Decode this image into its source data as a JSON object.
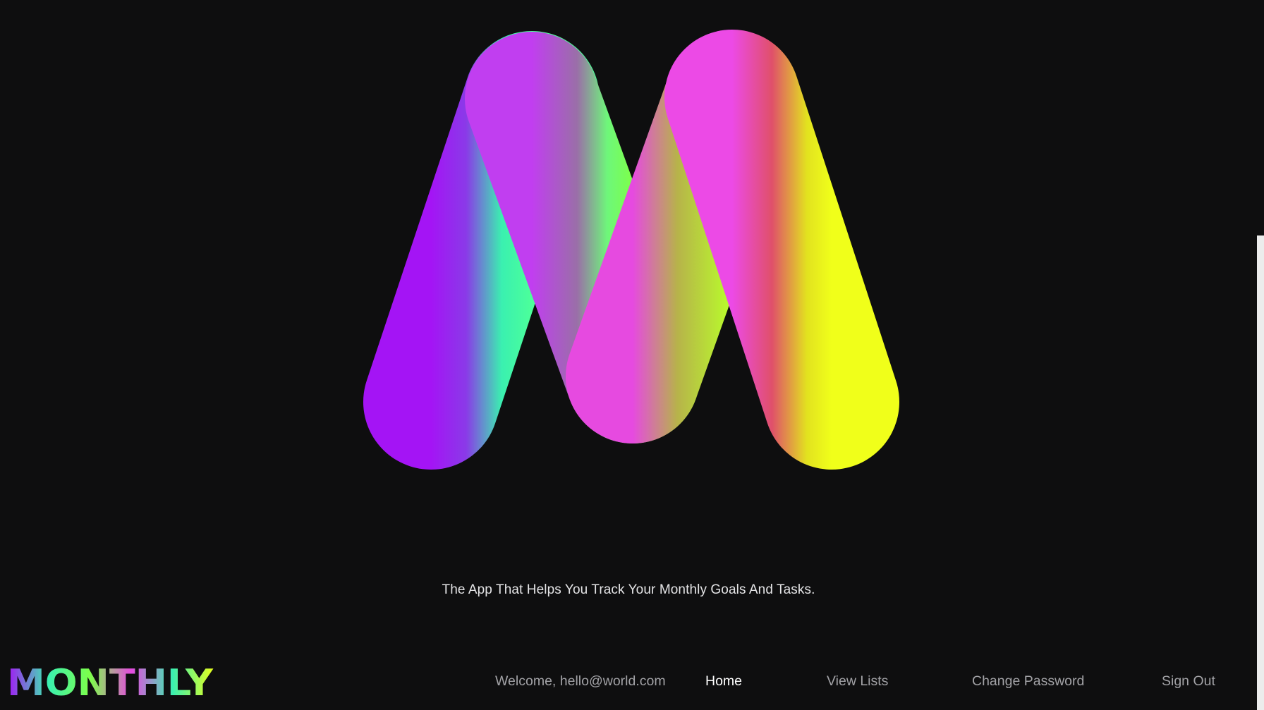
{
  "hero": {
    "logo_letter": "M",
    "tagline": "The App That Helps You Track Your Monthly Goals And Tasks."
  },
  "nav": {
    "brand": "MONTHLY",
    "welcome": "Welcome, hello@world.com",
    "links": [
      {
        "label": "Home",
        "active": true
      },
      {
        "label": "View Lists",
        "active": false
      },
      {
        "label": "Change Password",
        "active": false
      },
      {
        "label": "Sign Out",
        "active": false
      }
    ]
  },
  "colors": {
    "background": "#0e0e0f",
    "gradient": [
      "#a414f5",
      "#2ff5b6",
      "#7dff4a",
      "#f04ad8",
      "#eaff1a"
    ],
    "nav_text": "#a2a2a6",
    "nav_active": "#ffffff"
  }
}
